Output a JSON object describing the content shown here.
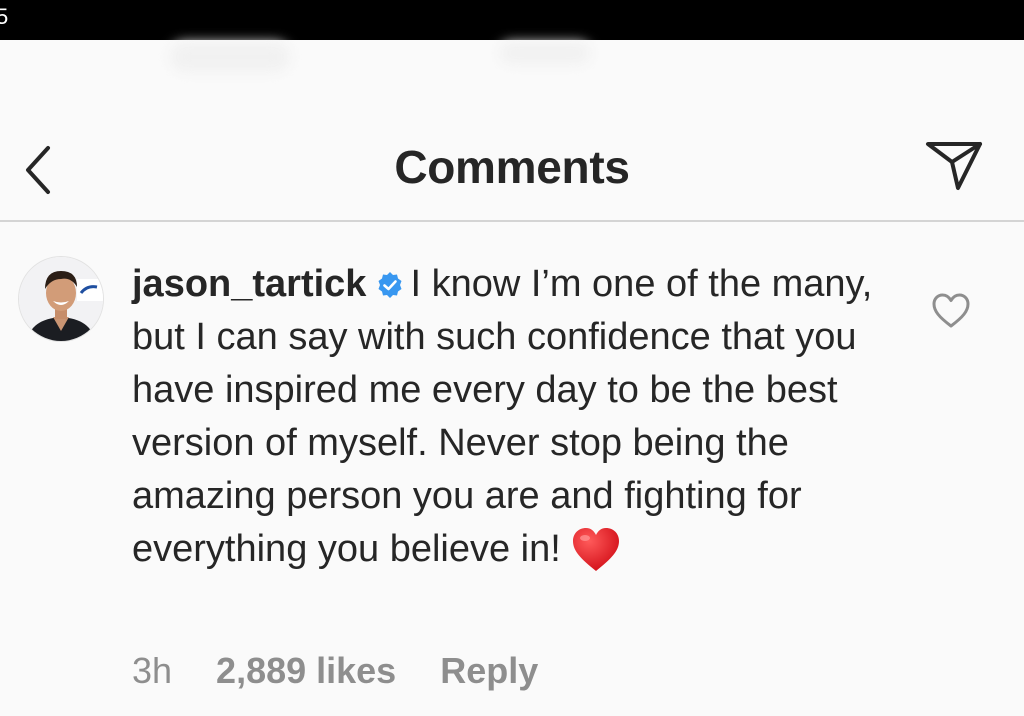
{
  "status_bar": {
    "text": "5"
  },
  "header": {
    "title": "Comments",
    "back_icon": "chevron-left-icon",
    "share_icon": "direct-send-icon"
  },
  "comment": {
    "username": "jason_tartick",
    "verified": true,
    "text": "I know I’m one of the many, but I can say with such confidence that you have inspired me every day to be the best version of myself. Never stop being the amazing person you are and fighting for everything you believe in!",
    "emoji": "red-heart",
    "time": "3h",
    "likes": "2,889 likes",
    "reply_label": "Reply",
    "like_icon": "heart-outline-icon"
  },
  "colors": {
    "text": "#262626",
    "meta": "#8e8e8e",
    "verified": "#3897f0",
    "heart_emoji": "#e0141e",
    "divider": "#d4d4d4",
    "status_bar": "#000000"
  }
}
